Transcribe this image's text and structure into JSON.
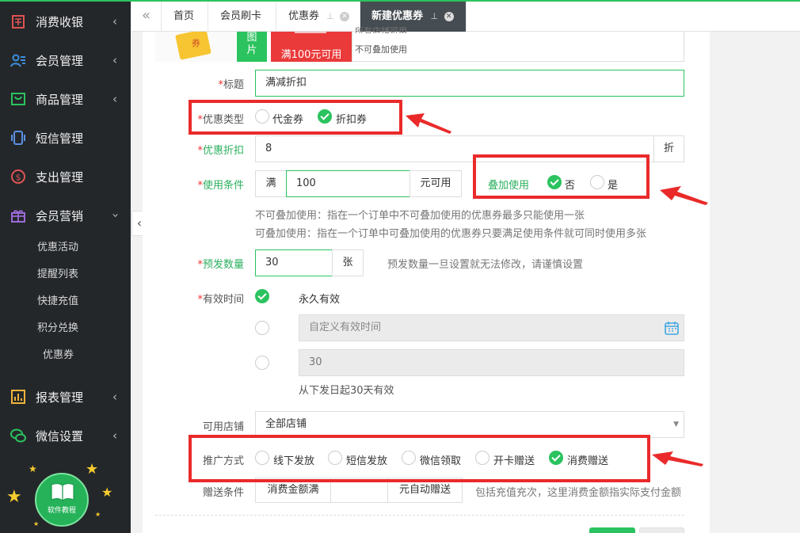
{
  "sidebar": {
    "items": [
      {
        "label": "消费收银",
        "icon": "cashier-icon"
      },
      {
        "label": "会员管理",
        "icon": "members-icon"
      },
      {
        "label": "商品管理",
        "icon": "goods-icon"
      },
      {
        "label": "短信管理",
        "icon": "sms-icon"
      },
      {
        "label": "支出管理",
        "icon": "expense-icon"
      },
      {
        "label": "会员营销",
        "icon": "gift-icon"
      },
      {
        "label": "报表管理",
        "icon": "report-icon"
      },
      {
        "label": "微信设置",
        "icon": "wechat-icon"
      }
    ],
    "sub_items": [
      "优惠活动",
      "提醒列表",
      "快捷充值",
      "积分兑换",
      "优惠券"
    ],
    "help_label": "软件教程"
  },
  "tabs": [
    {
      "label": "首页"
    },
    {
      "label": "会员刷卡"
    },
    {
      "label": "优惠券"
    },
    {
      "label": "新建优惠券"
    }
  ],
  "preview": {
    "upload_label_1": "图",
    "upload_label_2": "片",
    "coupon_condition": "满100元可用",
    "line_1": "所有店铺可用",
    "line_2": "不可叠加使用"
  },
  "form": {
    "title_label": "标题",
    "title_value": "满减折扣",
    "type_label": "优惠类型",
    "type_options": [
      "代金券",
      "折扣券"
    ],
    "discount_label": "优惠折扣",
    "discount_value": "8",
    "discount_unit": "折",
    "condition_label": "使用条件",
    "condition_prefix": "满",
    "condition_value": "100",
    "condition_suffix": "元可用",
    "stack_label": "叠加使用",
    "stack_options": [
      "否",
      "是"
    ],
    "hint_1": "不可叠加使用：指在一个订单中不可叠加使用的优惠券最多只能使用一张",
    "hint_2": "可叠加使用：指在一个订单中可叠加使用的优惠券只要满足使用条件就可同时使用多张",
    "quantity_label": "预发数量",
    "quantity_value": "30",
    "quantity_unit": "张",
    "quantity_hint": "预发数量一旦设置就无法修改，请谨慎设置",
    "validity_label": "有效时间",
    "validity_forever": "永久有效",
    "validity_custom_placeholder": "自定义有效时间",
    "validity_days_value": "30",
    "validity_days_hint": "从下发日起30天有效",
    "store_label": "可用店铺",
    "store_value": "全部店铺",
    "promo_label": "推广方式",
    "promo_options": [
      "线下发放",
      "短信发放",
      "微信领取",
      "开卡赠送",
      "消费赠送"
    ],
    "gift_label": "赠送条件",
    "gift_prefix": "消费金额满",
    "gift_suffix": "元自动赠送",
    "gift_hint": "包括充值充次，这里消费金额指实际支付金额"
  },
  "colors": {
    "accent": "#2bc35f",
    "annotation": "#ea2a2a",
    "sidebar_bg": "#24272a"
  }
}
